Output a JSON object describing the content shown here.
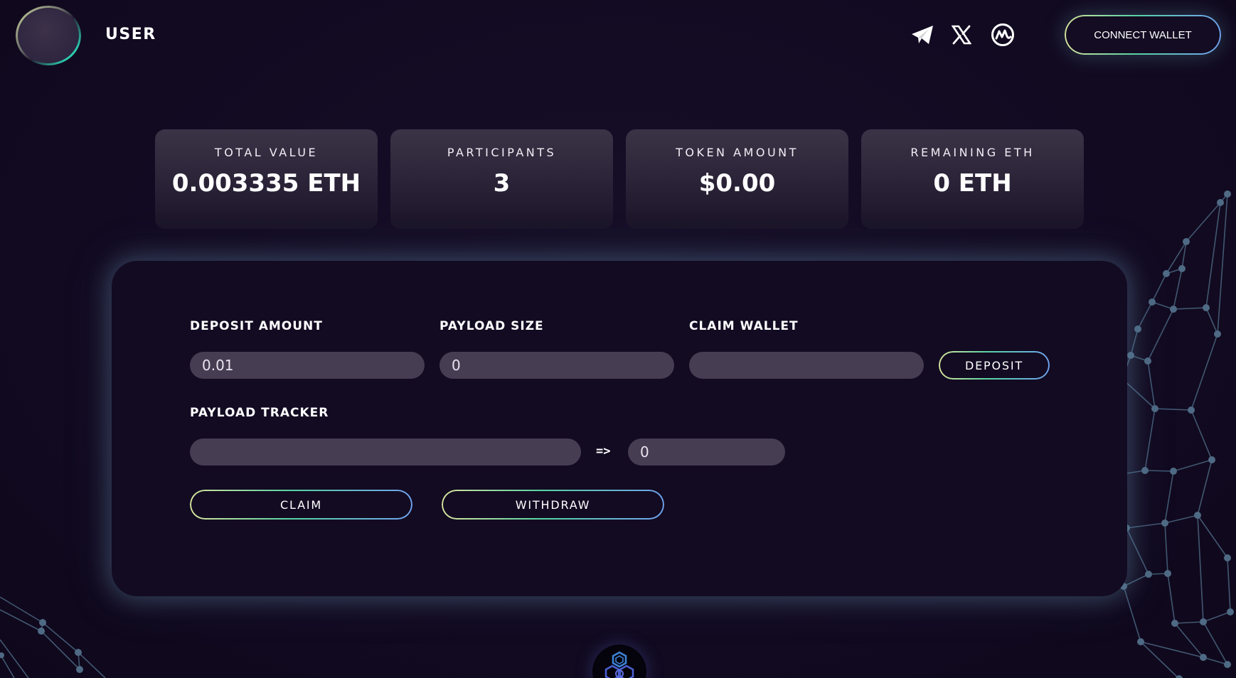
{
  "header": {
    "brand": "USER",
    "connect_label": "CONNECT WALLET",
    "social_icons": [
      "telegram-icon",
      "x-icon",
      "coinmarketcap-icon"
    ]
  },
  "stats": [
    {
      "label": "TOTAL VALUE",
      "value": "0.003335 ETH"
    },
    {
      "label": "PARTICIPANTS",
      "value": "3"
    },
    {
      "label": "TOKEN AMOUNT",
      "value": "$0.00"
    },
    {
      "label": "REMAINING ETH",
      "value": "0 ETH"
    }
  ],
  "deposit": {
    "amount_label": "DEPOSIT AMOUNT",
    "amount_value": "0.01",
    "payload_label": "PAYLOAD SIZE",
    "payload_value": "0",
    "wallet_label": "CLAIM WALLET",
    "wallet_value": "",
    "button_label": "DEPOSIT"
  },
  "tracker": {
    "label": "PAYLOAD TRACKER",
    "input_value": "",
    "arrow": "=>",
    "result_value": "0"
  },
  "actions": {
    "claim_label": "CLAIM",
    "withdraw_label": "WITHDRAW"
  },
  "colors": {
    "background": "#130b22",
    "input_bg": "#463d53",
    "gradient_start": "#d7e49c",
    "gradient_mid": "#57d3a4",
    "gradient_end": "#6fa3f0"
  }
}
